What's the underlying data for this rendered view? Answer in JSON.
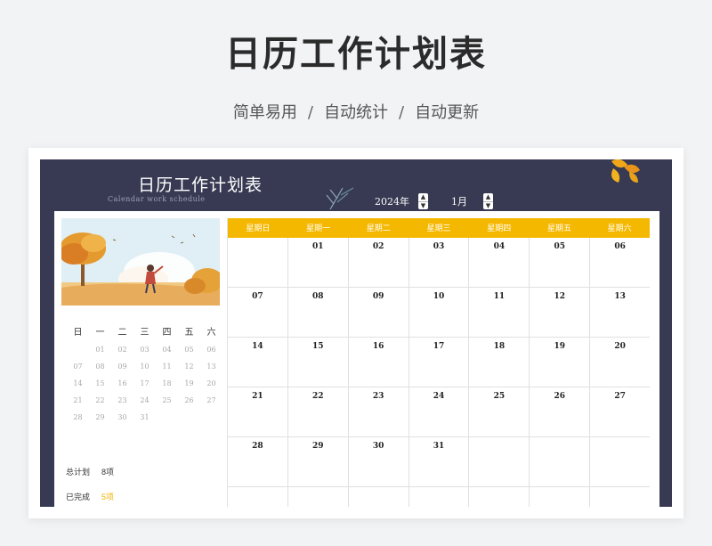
{
  "hero": {
    "title": "日历工作计划表",
    "tags": [
      "简单易用",
      "自动统计",
      "自动更新"
    ],
    "separator": "/"
  },
  "sheet": {
    "title": "日历工作计划表",
    "subtitle": "Calendar work schedule",
    "year_label": "2024年",
    "month_label": "1月",
    "spinner_up_icon": "▲",
    "spinner_down_icon": "▼"
  },
  "mini_calendar": {
    "weekdays": [
      "日",
      "一",
      "二",
      "三",
      "四",
      "五",
      "六"
    ],
    "weeks": [
      [
        "",
        "01",
        "02",
        "03",
        "04",
        "05",
        "06"
      ],
      [
        "07",
        "08",
        "09",
        "10",
        "11",
        "12",
        "13"
      ],
      [
        "14",
        "15",
        "16",
        "17",
        "18",
        "19",
        "20"
      ],
      [
        "21",
        "22",
        "23",
        "24",
        "25",
        "26",
        "27"
      ],
      [
        "28",
        "29",
        "30",
        "31",
        "",
        "",
        ""
      ]
    ]
  },
  "stats": [
    {
      "label": "总计划",
      "value": "8项",
      "highlight": false
    },
    {
      "label": "已完成",
      "value": "5项",
      "highlight": true
    }
  ],
  "calendar": {
    "weekdays": [
      "星期日",
      "星期一",
      "星期二",
      "星期三",
      "星期四",
      "星期五",
      "星期六"
    ],
    "weeks": [
      [
        "",
        "01",
        "02",
        "03",
        "04",
        "05",
        "06"
      ],
      [
        "07",
        "08",
        "09",
        "10",
        "11",
        "12",
        "13"
      ],
      [
        "14",
        "15",
        "16",
        "17",
        "18",
        "19",
        "20"
      ],
      [
        "21",
        "22",
        "23",
        "24",
        "25",
        "26",
        "27"
      ],
      [
        "28",
        "29",
        "30",
        "31",
        "",
        "",
        ""
      ],
      [
        "",
        "",
        "",
        "",
        "",
        "",
        ""
      ]
    ]
  },
  "colors": {
    "header_bg": "#373a52",
    "accent": "#f5b800",
    "completed": "#f0b400"
  },
  "icons": {
    "illustration": "autumn-girl-illustration",
    "leaf_left": "leaf-sprig-icon",
    "leaf_corner": "autumn-leaves-icon"
  }
}
